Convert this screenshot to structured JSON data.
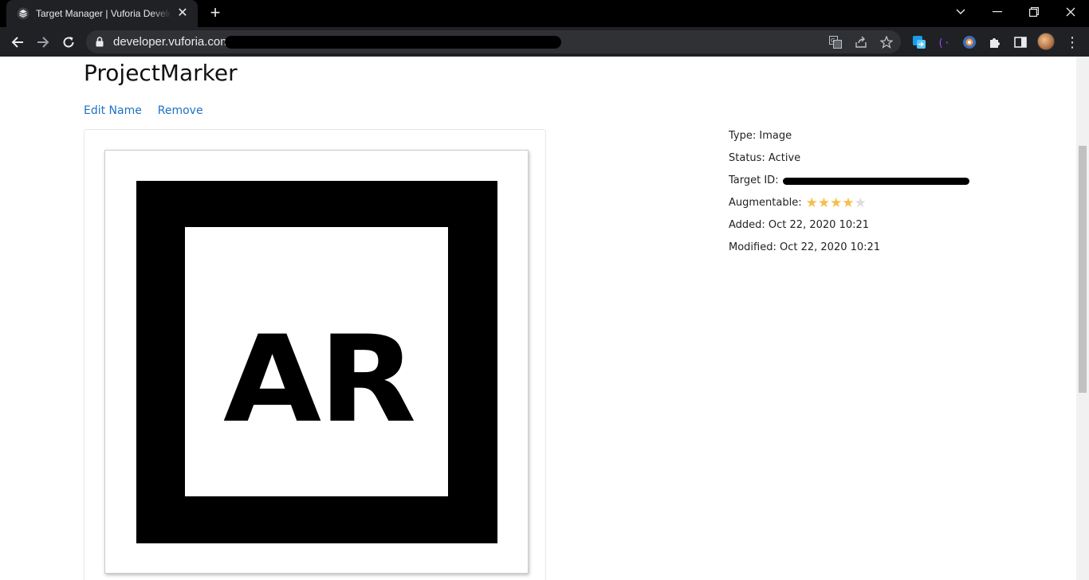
{
  "browser": {
    "tab_title": "Target Manager | Vuforia Developer Portal",
    "new_tab_label": "+",
    "close_tab_label": "✕",
    "url_host": "developer.vuforia.com/",
    "more_label": "⋮"
  },
  "page": {
    "title": "ProjectMarker",
    "actions": {
      "edit_name": "Edit Name",
      "remove": "Remove"
    },
    "marker_image_text": "AR",
    "details": {
      "type": "Type: Image",
      "status": "Status: Active",
      "target_id_label": "Target ID:",
      "augmentable_label": "Augmentable:",
      "augmentable_rating": 4,
      "augmentable_max": 5,
      "added": "Added: Oct 22, 2020 10:21",
      "modified": "Modified: Oct 22, 2020 10:21"
    }
  },
  "colors": {
    "link": "#1d72c4",
    "star_filled": "#f5c04a",
    "star_empty": "#dddddd",
    "chrome_bg": "#202124",
    "tabstrip_bg": "#000000"
  }
}
